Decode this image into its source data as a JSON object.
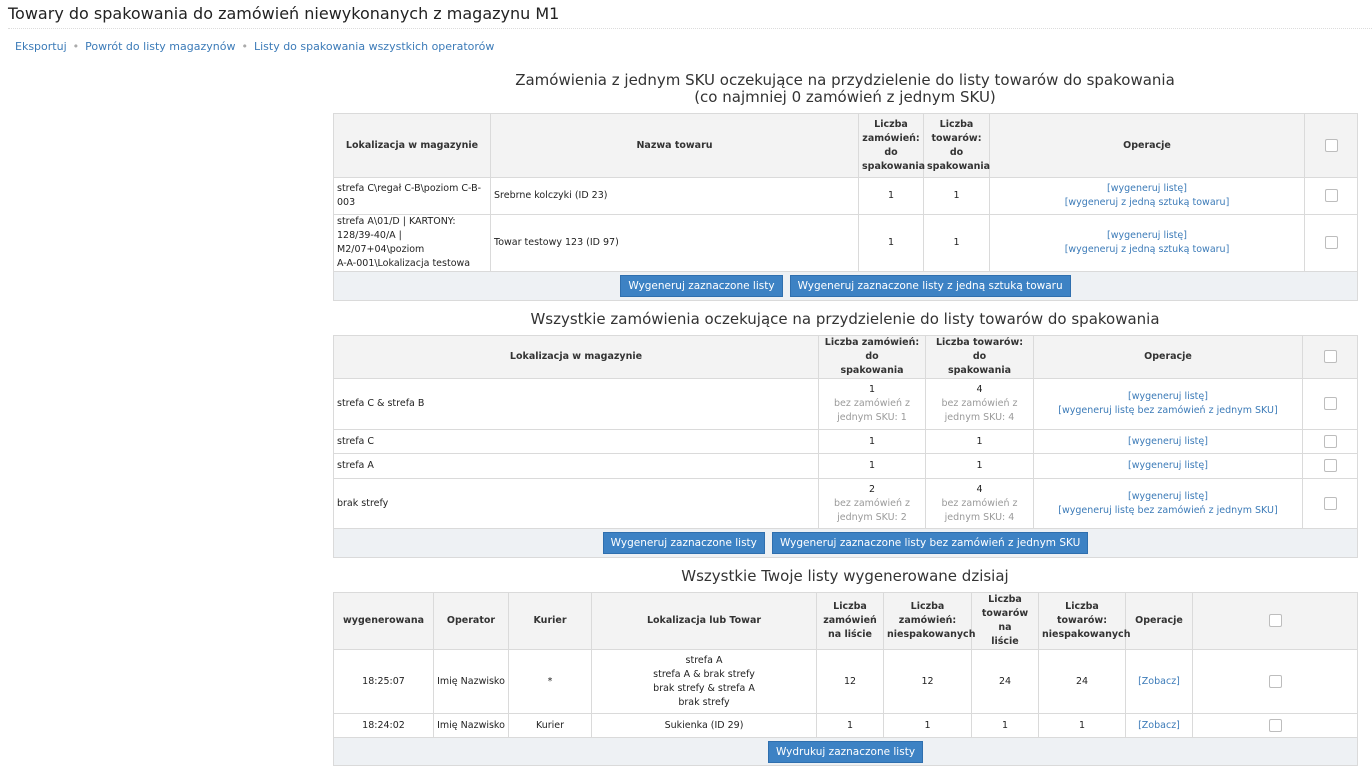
{
  "page": {
    "title": "Towary do spakowania do zamówień niewykonanych z magazynu M1",
    "nav": [
      "Eksportuj",
      "Powrót do listy magazynów",
      "Listy do spakowania wszystkich operatorów"
    ]
  },
  "single_sku": {
    "title1": "Zamówienia z jednym SKU oczekujące na przydzielenie do listy towarów do spakowania",
    "title2": "(co najmniej 0 zamówień z jednym SKU)",
    "headers": {
      "location": "Lokalizacja w magazynie",
      "product": "Nazwa towaru",
      "orders_l1": "Liczba",
      "orders_l2": "zamówień:",
      "orders_l3": "do",
      "orders_l4": "spakowania",
      "items_l1": "Liczba",
      "items_l2": "towarów:",
      "items_l3": "do",
      "items_l4": "spakowania",
      "operations": "Operacje"
    },
    "rows": [
      {
        "location_l1": "strefa C\\regał C-B\\poziom C-B-",
        "location_l2": "003",
        "product": "Srebrne kolczyki (ID 23)",
        "orders": "1",
        "items": "1",
        "op1": "[wygeneruj listę]",
        "op2": "[wygeneruj z jedną sztuką towaru]"
      },
      {
        "location_l1": "strefa A\\01/D | KARTONY:",
        "location_l2": "128/39-40/A | M2/07+04\\poziom",
        "location_l3": "A-A-001\\Lokalizacja testowa",
        "product": "Towar testowy 123 (ID 97)",
        "orders": "1",
        "items": "1",
        "op1": "[wygeneruj listę]",
        "op2": "[wygeneruj z jedną sztuką towaru]"
      }
    ],
    "btn_generate": "Wygeneruj zaznaczone listy",
    "btn_generate_single": "Wygeneruj zaznaczone listy z jedną sztuką towaru"
  },
  "all_orders": {
    "title": "Wszystkie zamówienia oczekujące na przydzielenie do listy towarów do spakowania",
    "headers": {
      "location": "Lokalizacja w magazynie",
      "orders_l1": "Liczba zamówień: do",
      "orders_l2": "spakowania",
      "items_l1": "Liczba towarów: do",
      "items_l2": "spakowania",
      "operations": "Operacje"
    },
    "rows": [
      {
        "location": "strefa C & strefa B",
        "orders": "1",
        "orders_sub1": "bez zamówień z",
        "orders_sub2": "jednym SKU: 1",
        "items": "4",
        "items_sub1": "bez zamówień z",
        "items_sub2": "jednym SKU: 4",
        "op1": "[wygeneruj listę]",
        "op2": "[wygeneruj listę bez zamówień z jednym SKU]"
      },
      {
        "location": "strefa C",
        "orders": "1",
        "items": "1",
        "op1": "[wygeneruj listę]"
      },
      {
        "location": "strefa A",
        "orders": "1",
        "items": "1",
        "op1": "[wygeneruj listę]"
      },
      {
        "location": "brak strefy",
        "orders": "2",
        "orders_sub1": "bez zamówień z",
        "orders_sub2": "jednym SKU: 2",
        "items": "4",
        "items_sub1": "bez zamówień z",
        "items_sub2": "jednym SKU: 4",
        "op1": "[wygeneruj listę]",
        "op2": "[wygeneruj listę bez zamówień z jednym SKU]"
      }
    ],
    "btn_generate": "Wygeneruj zaznaczone listy",
    "btn_generate_no_single": "Wygeneruj zaznaczone listy bez zamówień z jednym SKU"
  },
  "my_lists": {
    "title": "Wszystkie Twoje listy wygenerowane dzisiaj",
    "headers": {
      "generated": "wygenerowana",
      "operator": "Operator",
      "courier": "Kurier",
      "location": "Lokalizacja lub Towar",
      "orders_l1": "Liczba",
      "orders_l2": "zamówień",
      "orders_l3": "na liście",
      "unpacked_l1": "Liczba",
      "unpacked_l2": "zamówień:",
      "unpacked_l3": "niespakowanych",
      "items_l1": "Liczba",
      "items_l2": "towarów na",
      "items_l3": "liście",
      "items_unpacked_l1": "Liczba towarów:",
      "items_unpacked_l2": "niespakowanych",
      "operations": "Operacje"
    },
    "rows": [
      {
        "time": "18:25:07",
        "operator": "Imię Nazwisko",
        "courier": "*",
        "loc1": "strefa A",
        "loc2": "strefa A & brak strefy",
        "loc3": "brak strefy & strefa A",
        "loc4": "brak strefy",
        "orders": "12",
        "unpacked": "12",
        "items": "24",
        "items_unpacked": "24",
        "op": "[Zobacz]"
      },
      {
        "time": "18:24:02",
        "operator": "Imię Nazwisko",
        "courier": "Kurier",
        "loc1": "Sukienka (ID 29)",
        "orders": "1",
        "unpacked": "1",
        "items": "1",
        "items_unpacked": "1",
        "op": "[Zobacz]"
      }
    ],
    "btn_print": "Wydrukuj zaznaczone listy"
  }
}
